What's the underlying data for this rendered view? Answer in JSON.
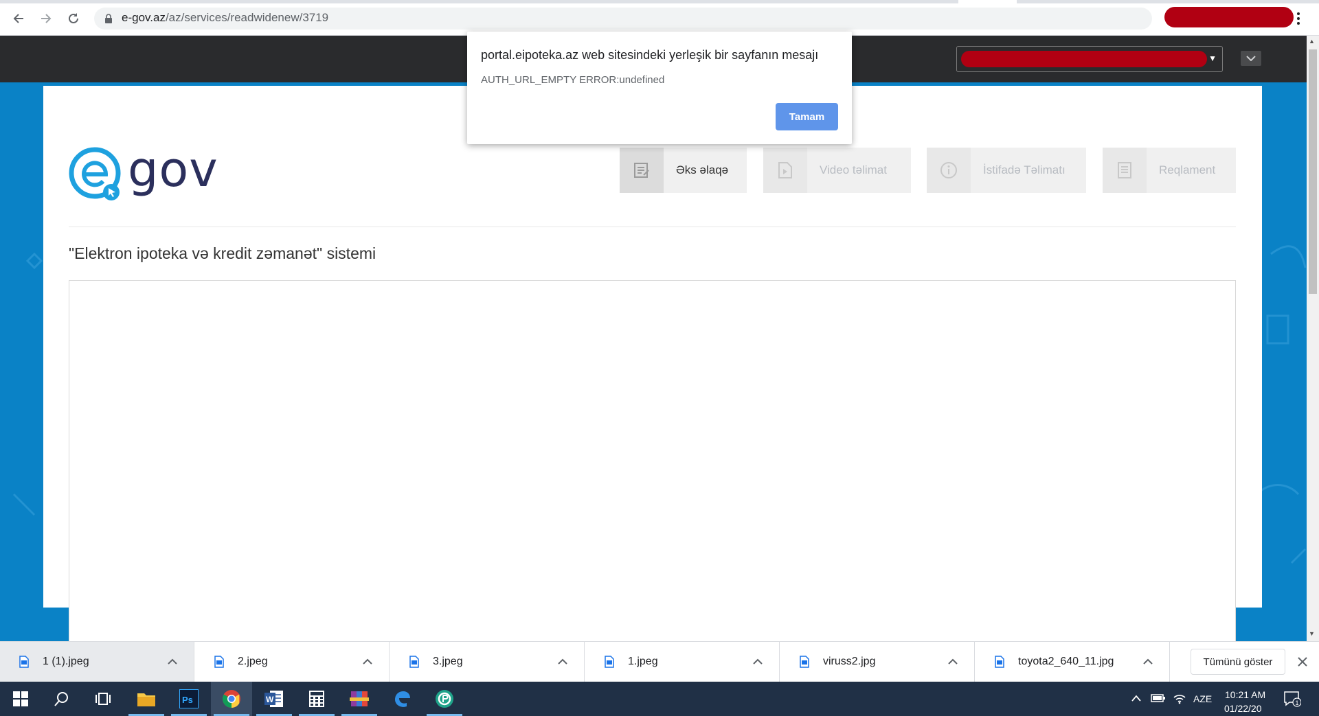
{
  "browser": {
    "url_host": "e-gov.az",
    "url_path": "/az/services/readwidenew/3719"
  },
  "page": {
    "logo_text": "gov",
    "buttons": {
      "feedback": "Əks əlaqə",
      "video": "Video təlimat",
      "usage": "İstifadə Təlimatı",
      "reglament": "Reqlament"
    },
    "service_title": "\"Elektron ipoteka və kredit zəmanət\" sistemi"
  },
  "dialog": {
    "title": "portal.eipoteka.az web sitesindeki yerleşik bir sayfanın mesajı",
    "message": "AUTH_URL_EMPTY ERROR:undefined",
    "ok_label": "Tamam"
  },
  "downloads": {
    "items": [
      {
        "name": "1 (1).jpeg"
      },
      {
        "name": "2.jpeg"
      },
      {
        "name": "3.jpeg"
      },
      {
        "name": "1.jpeg"
      },
      {
        "name": "viruss2.jpg"
      },
      {
        "name": "toyota2_640_11.jpg"
      }
    ],
    "show_all_label": "Tümünü göster"
  },
  "taskbar": {
    "apps": [
      "start-icon",
      "search-icon",
      "task-view-icon",
      "file-explorer-icon",
      "photoshop-icon",
      "chrome-icon",
      "word-icon",
      "calculator-icon",
      "winrar-icon",
      "edge-icon",
      "bitdefender-icon"
    ],
    "language": "AZE",
    "time": "10:21 AM",
    "date": "01/22/20"
  },
  "colors": {
    "page_blue": "#0a82c6",
    "dialog_button": "#5f95ea",
    "redaction": "#b10012",
    "taskbar": "#203046"
  }
}
